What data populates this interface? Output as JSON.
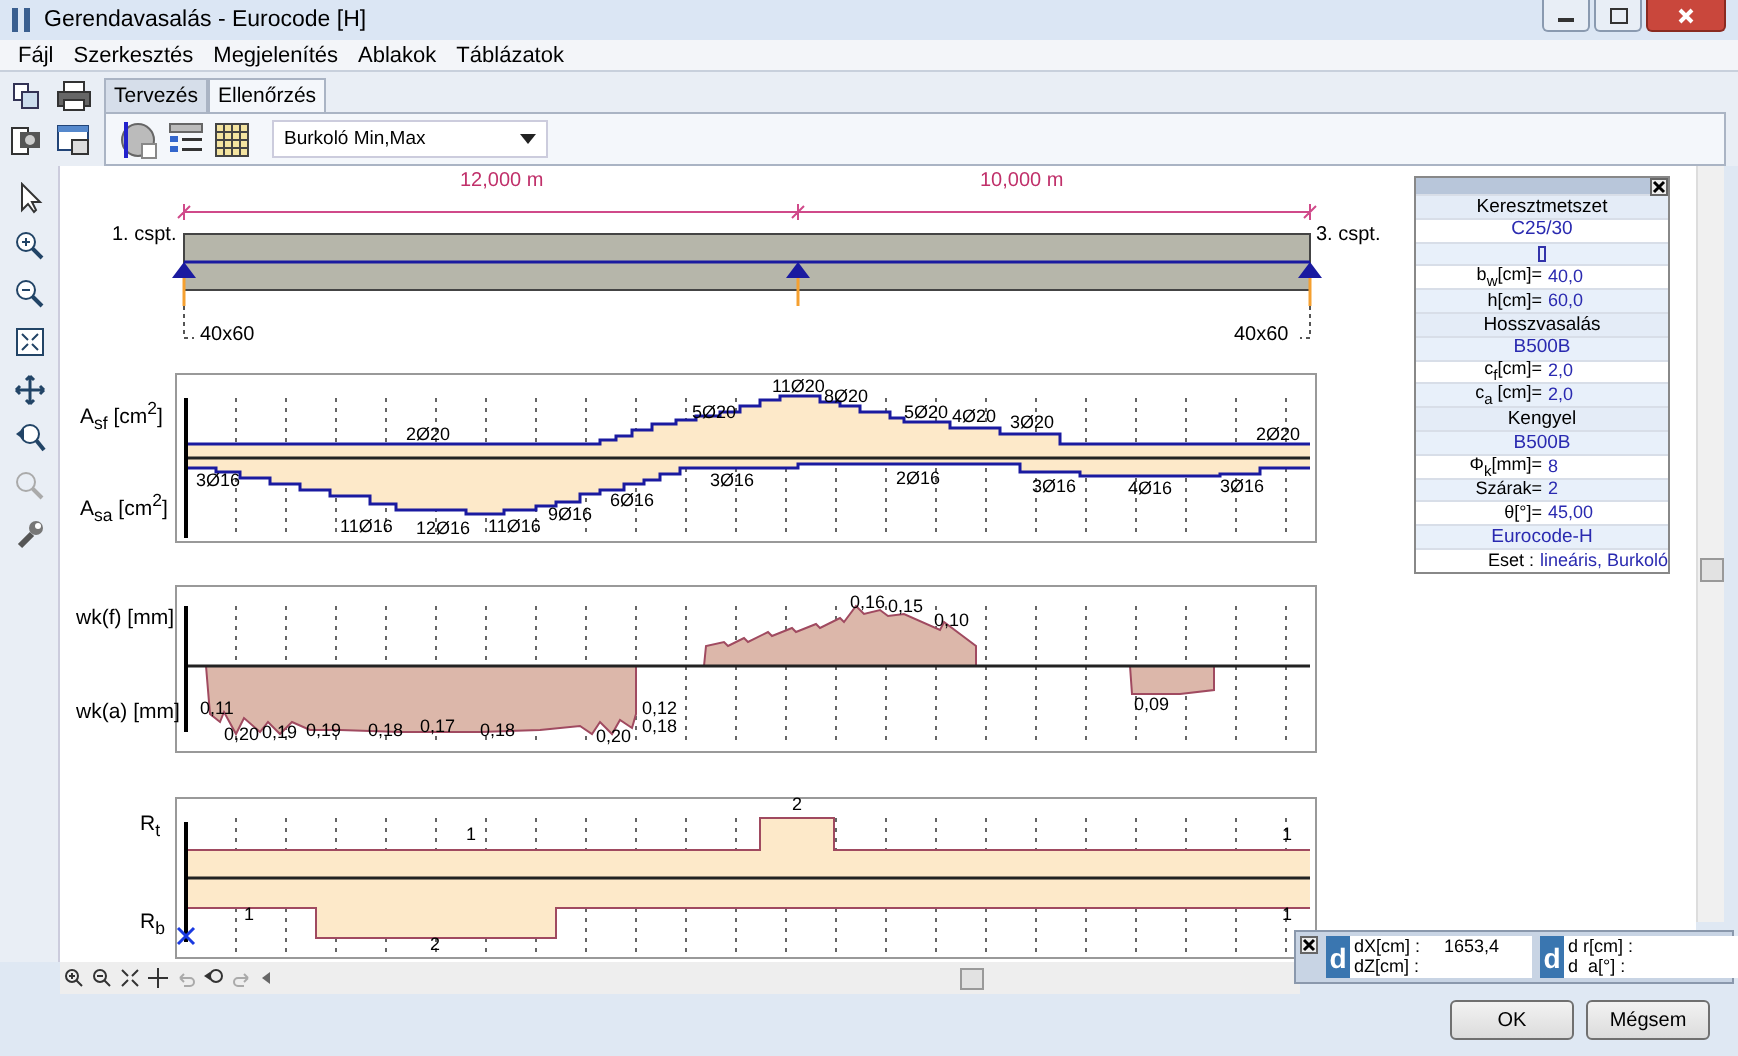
{
  "window": {
    "title": "Gerendavasalás - Eurocode [H]"
  },
  "menu": [
    "Fájl",
    "Szerkesztés",
    "Megjelenítés",
    "Ablakok",
    "Táblázatok"
  ],
  "tabs": [
    {
      "label": "Tervezés",
      "selected": false
    },
    {
      "label": "Ellenőrzés",
      "selected": true
    }
  ],
  "dropdown": {
    "value": "Burkoló Min,Max"
  },
  "beam": {
    "spans": [
      "12,000 m",
      "10,000 m"
    ],
    "node_labels": [
      "1. cspt.",
      "3. cspt."
    ],
    "sections": [
      "40x60",
      "40x60"
    ]
  },
  "reinforcement": {
    "top_label": "A$_{sf}$ [cm$^{2}$]",
    "bottom_label": "A$_{sa}$ [cm$^{2}$]",
    "top_bars": [
      "2Ø20",
      "5Ø20",
      "11Ø20",
      "8Ø20",
      "5Ø20",
      "4Ø20",
      "3Ø20",
      "2Ø20"
    ],
    "bottom_bars": [
      "3Ø16",
      "11Ø16",
      "12Ø16",
      "11Ø16",
      "9Ø16",
      "6Ø16",
      "3Ø16",
      "2Ø16",
      "3Ø16",
      "4Ø16",
      "3Ø16"
    ]
  },
  "crack_width": {
    "top_label": "wk(f) [mm]",
    "bottom_label": "wk(a) [mm]",
    "top_values": [
      "0,16",
      "0,15",
      "0,10"
    ],
    "bottom_values": [
      "0,11",
      "0,20",
      "0,19",
      "0,19",
      "0,18",
      "0,17",
      "0,18",
      "0,20",
      "0,12",
      "0,18",
      "0,09"
    ]
  },
  "stirrups": {
    "top_label": "R$_{t}$",
    "bottom_label": "R$_{b}$",
    "top_values": [
      "1",
      "2",
      "1"
    ],
    "bottom_values": [
      "1",
      "2",
      "1"
    ]
  },
  "panel": {
    "rows": [
      {
        "kind": "header",
        "text": "Keresztmetszet"
      },
      {
        "kind": "value",
        "text": "C25/30"
      },
      {
        "kind": "shape"
      },
      {
        "kind": "param",
        "label": "b$_{w}$[cm]=",
        "value": "40,0"
      },
      {
        "kind": "param",
        "label": "h[cm]=",
        "value": "60,0"
      },
      {
        "kind": "header",
        "text": "Hosszvasalás"
      },
      {
        "kind": "value",
        "text": "B500B"
      },
      {
        "kind": "param",
        "label": "c$_{f}$[cm]=",
        "value": "2,0"
      },
      {
        "kind": "param",
        "label": "c$_{a}$ [cm]=",
        "value": "2,0"
      },
      {
        "kind": "header",
        "text": "Kengyel"
      },
      {
        "kind": "value",
        "text": "B500B"
      },
      {
        "kind": "param",
        "label": "Φ$_{k}$[mm]=",
        "value": "8"
      },
      {
        "kind": "param",
        "label": "Szárak=",
        "value": "2"
      },
      {
        "kind": "param",
        "label": "θ[°]=",
        "value": "45,00"
      },
      {
        "kind": "value",
        "text": "Eurocode-H"
      },
      {
        "kind": "param",
        "label": "Eset  :",
        "value": "lineáris, Burkoló"
      }
    ]
  },
  "coordinates": [
    {
      "badge": "d",
      "rows": [
        {
          "label": "dX[cm] :",
          "value": "1653,4"
        },
        {
          "label": "dZ[cm] :"
        }
      ]
    },
    {
      "badge": "d",
      "rows": [
        {
          "label": "d r[cm] :"
        },
        {
          "label": "d  a[°] :"
        }
      ]
    }
  ],
  "buttons": [
    "OK",
    "Mégsem"
  ]
}
